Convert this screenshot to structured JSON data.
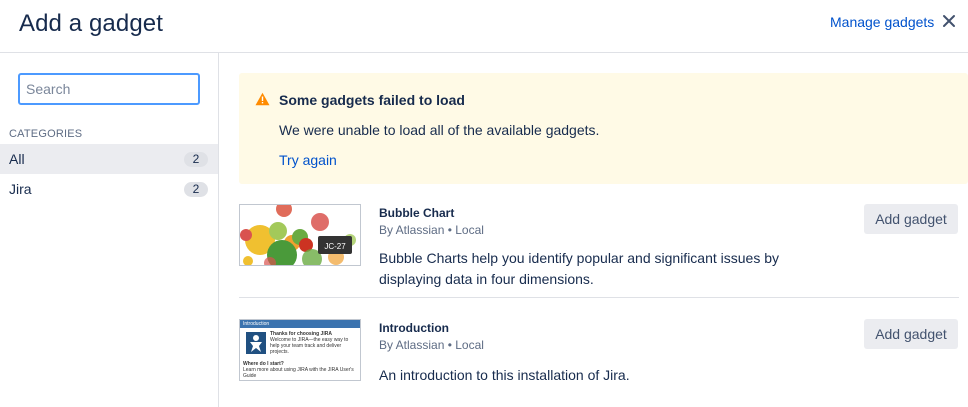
{
  "header": {
    "title": "Add a gadget",
    "manage_link": "Manage gadgets",
    "close_icon": "close-icon"
  },
  "sidebar": {
    "search": {
      "placeholder": "Search",
      "value": ""
    },
    "categories_heading": "CATEGORIES",
    "categories": [
      {
        "label": "All",
        "count": "2",
        "selected": true
      },
      {
        "label": "Jira",
        "count": "2",
        "selected": false
      }
    ]
  },
  "warning": {
    "icon": "warning-icon",
    "title": "Some gadgets failed to load",
    "body": "We were unable to load all of the available gadgets.",
    "link": "Try again",
    "background": "#fffae6",
    "icon_color": "#ff8b00"
  },
  "gadgets": [
    {
      "title": "Bubble Chart",
      "meta": "By Atlassian • Local",
      "description": "Bubble Charts help you identify popular and significant issues by displaying data in four dimensions.",
      "button": "Add gadget",
      "thumbnail_label": "JC-27"
    },
    {
      "title": "Introduction",
      "meta": "By Atlassian • Local",
      "description": "An introduction to this installation of Jira.",
      "button": "Add gadget",
      "thumbnail": {
        "header": "Introduction",
        "heading": "Thanks for choosing JIRA",
        "text": "Welcome to JIRA—the easy way to help your team track and deliver projects.",
        "subheading": "Where do I start?",
        "subtext": "Learn more about using JIRA with the JIRA User's Guide"
      }
    }
  ],
  "colors": {
    "link": "#0052cc",
    "focus": "#4c9aff",
    "selected_bg": "#ebecf0"
  }
}
